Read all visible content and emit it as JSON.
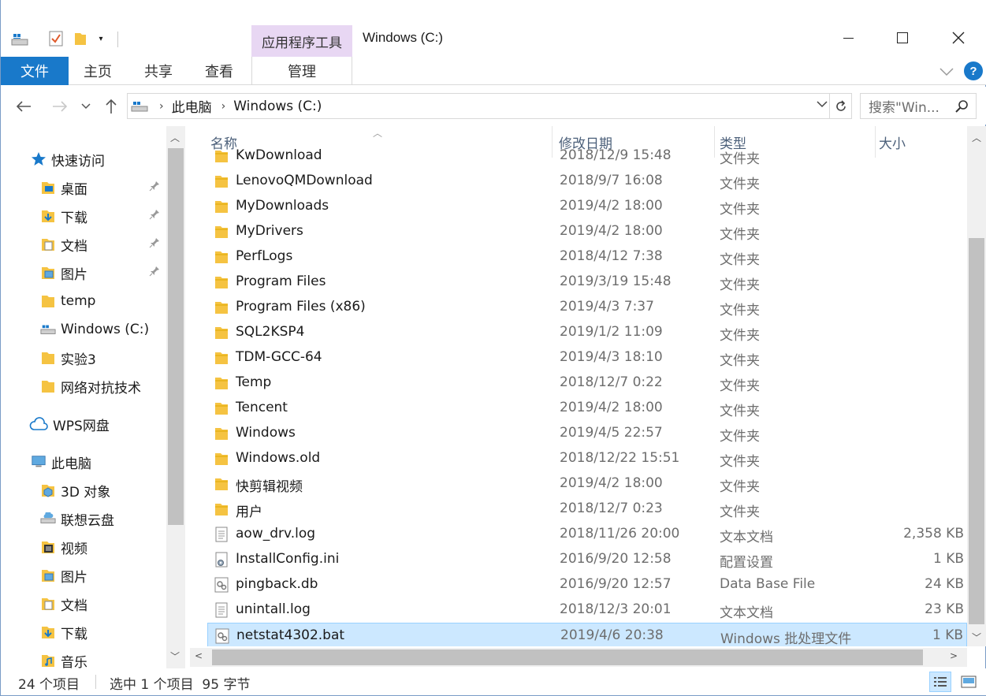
{
  "window": {
    "title": "Windows (C:)",
    "context_tab": "应用程序工具"
  },
  "ribbon": {
    "tabs": [
      {
        "label": "文件"
      },
      {
        "label": "主页"
      },
      {
        "label": "共享"
      },
      {
        "label": "查看"
      },
      {
        "label": "管理"
      }
    ],
    "help": "?"
  },
  "nav": {
    "breadcrumb": [
      "此电脑",
      "Windows (C:)"
    ],
    "search_placeholder": "搜索\"Win..."
  },
  "sidebar": {
    "quick_access": "快速访问",
    "quick_items": [
      {
        "label": "桌面",
        "icon": "desktop-folder-icon",
        "pinned": true
      },
      {
        "label": "下载",
        "icon": "download-folder-icon",
        "pinned": true
      },
      {
        "label": "文档",
        "icon": "documents-folder-icon",
        "pinned": true
      },
      {
        "label": "图片",
        "icon": "pictures-folder-icon",
        "pinned": true
      },
      {
        "label": "temp",
        "icon": "folder-icon",
        "pinned": false
      },
      {
        "label": "Windows (C:)",
        "icon": "drive-icon",
        "pinned": false
      },
      {
        "label": "实验3",
        "icon": "folder-icon",
        "pinned": false
      },
      {
        "label": "网络对抗技术",
        "icon": "folder-icon",
        "pinned": false
      }
    ],
    "wps": "WPS网盘",
    "this_pc": "此电脑",
    "pc_items": [
      {
        "label": "3D 对象",
        "icon": "3d-objects-icon"
      },
      {
        "label": "联想云盘",
        "icon": "cloud-drive-icon"
      },
      {
        "label": "视频",
        "icon": "videos-folder-icon"
      },
      {
        "label": "图片",
        "icon": "pictures-folder-icon"
      },
      {
        "label": "文档",
        "icon": "documents-folder-icon"
      },
      {
        "label": "下载",
        "icon": "download-folder-icon"
      },
      {
        "label": "音乐",
        "icon": "music-folder-icon"
      }
    ]
  },
  "columns": {
    "name": "名称",
    "date": "修改日期",
    "type": "类型",
    "size": "大小"
  },
  "files": [
    {
      "name": "KwDownload",
      "date": "2018/12/9 15:48",
      "type": "文件夹",
      "size": "",
      "kind": "folder"
    },
    {
      "name": "LenovoQMDownload",
      "date": "2018/9/7 16:08",
      "type": "文件夹",
      "size": "",
      "kind": "folder"
    },
    {
      "name": "MyDownloads",
      "date": "2019/4/2 18:00",
      "type": "文件夹",
      "size": "",
      "kind": "folder"
    },
    {
      "name": "MyDrivers",
      "date": "2019/4/2 18:00",
      "type": "文件夹",
      "size": "",
      "kind": "folder"
    },
    {
      "name": "PerfLogs",
      "date": "2018/4/12 7:38",
      "type": "文件夹",
      "size": "",
      "kind": "folder"
    },
    {
      "name": "Program Files",
      "date": "2019/3/19 15:48",
      "type": "文件夹",
      "size": "",
      "kind": "folder"
    },
    {
      "name": "Program Files (x86)",
      "date": "2019/4/3 7:37",
      "type": "文件夹",
      "size": "",
      "kind": "folder"
    },
    {
      "name": "SQL2KSP4",
      "date": "2019/1/2 11:09",
      "type": "文件夹",
      "size": "",
      "kind": "folder"
    },
    {
      "name": "TDM-GCC-64",
      "date": "2019/4/3 18:10",
      "type": "文件夹",
      "size": "",
      "kind": "folder"
    },
    {
      "name": "Temp",
      "date": "2018/12/7 0:22",
      "type": "文件夹",
      "size": "",
      "kind": "folder"
    },
    {
      "name": "Tencent",
      "date": "2019/4/2 18:00",
      "type": "文件夹",
      "size": "",
      "kind": "folder"
    },
    {
      "name": "Windows",
      "date": "2019/4/5 22:57",
      "type": "文件夹",
      "size": "",
      "kind": "folder"
    },
    {
      "name": "Windows.old",
      "date": "2018/12/22 15:51",
      "type": "文件夹",
      "size": "",
      "kind": "folder"
    },
    {
      "name": "快剪辑视频",
      "date": "2019/4/2 18:00",
      "type": "文件夹",
      "size": "",
      "kind": "folder"
    },
    {
      "name": "用户",
      "date": "2018/12/7 0:23",
      "type": "文件夹",
      "size": "",
      "kind": "folder"
    },
    {
      "name": "aow_drv.log",
      "date": "2018/11/26 20:00",
      "type": "文本文档",
      "size": "2,358 KB",
      "kind": "text"
    },
    {
      "name": "InstallConfig.ini",
      "date": "2016/9/20 12:58",
      "type": "配置设置",
      "size": "1 KB",
      "kind": "config"
    },
    {
      "name": "pingback.db",
      "date": "2016/9/20 12:57",
      "type": "Data Base File",
      "size": "24 KB",
      "kind": "data"
    },
    {
      "name": "unintall.log",
      "date": "2018/12/3 20:01",
      "type": "文本文档",
      "size": "23 KB",
      "kind": "text"
    },
    {
      "name": "netstat4302.bat",
      "date": "2019/4/6 20:38",
      "type": "Windows 批处理文件",
      "size": "1 KB",
      "kind": "batch",
      "selected": true
    }
  ],
  "status": {
    "count": "24 个项目",
    "selection": "选中 1 个项目  95 字节"
  },
  "colors": {
    "accent": "#1979ca",
    "selection_bg": "#cce8ff",
    "selection_border": "#99d1ff",
    "context_tab_bg": "#e8d7f3",
    "folder": "#f5c342"
  }
}
